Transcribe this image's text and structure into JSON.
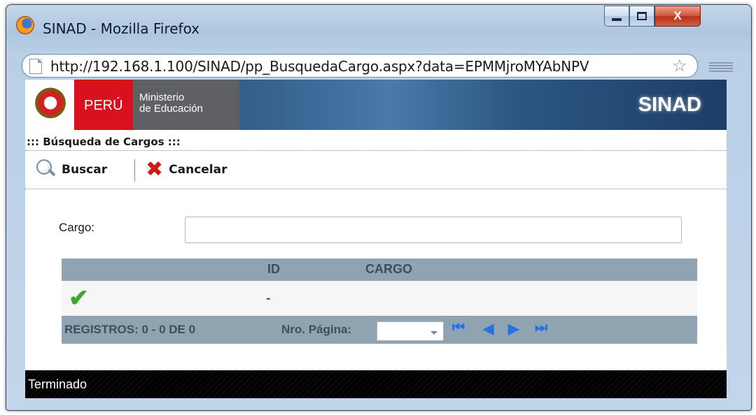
{
  "window": {
    "title": "SINAD - Mozilla Firefox",
    "url": "http://192.168.1.100/SINAD/pp_BusquedaCargo.aspx?data=EPMMjroMYAbNPV",
    "status": "Terminado",
    "close_glyph": "X"
  },
  "banner": {
    "country": "PERÚ",
    "ministry_line1": "Ministerio",
    "ministry_line2": "de Educación",
    "app_name": "SINAD"
  },
  "page": {
    "section_title": "::: Búsqueda de Cargos :::",
    "toolbar": {
      "search_label": "Buscar",
      "cancel_label": "Cancelar"
    },
    "form": {
      "cargo_label": "Cargo:",
      "cargo_value": ""
    },
    "grid": {
      "columns": [
        "",
        "ID",
        "CARGO"
      ],
      "rows": [
        {
          "select_icon": "check-icon",
          "id": "-",
          "cargo": ""
        }
      ],
      "footer": {
        "records": "REGISTROS: 0 - 0 DE 0",
        "page_label": "Nro. Página:",
        "page_value": ""
      }
    }
  },
  "icons": {
    "firefox": "firefox-logo-icon",
    "minimize": "minimize-icon",
    "maximize": "maximize-icon",
    "close": "close-icon",
    "page": "page-icon",
    "bookmark": "star-icon",
    "menu": "menu-icon",
    "search": "search-icon",
    "cancel": "cancel-x-icon",
    "first": "first-page-icon",
    "prev": "prev-page-icon",
    "next": "next-page-icon",
    "last": "last-page-icon"
  },
  "colors": {
    "peru_red": "#d9111e",
    "ministry_gray": "#5f6063",
    "grid_header": "#8fa3b0",
    "pager_blue": "#2a6ee8",
    "check_green": "#3caa2a"
  }
}
